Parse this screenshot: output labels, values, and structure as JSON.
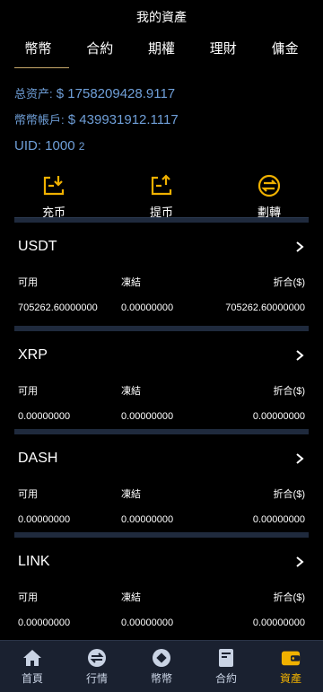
{
  "header": {
    "title": "我的資產"
  },
  "tabs": [
    {
      "label": "幣幣",
      "active": true
    },
    {
      "label": "合約"
    },
    {
      "label": "期權"
    },
    {
      "label": "理財"
    },
    {
      "label": "傭金"
    }
  ],
  "summary": {
    "total_label": "总资产:",
    "total_value": "$ 1758209428.9117",
    "coin_label": "幣幣帳戶:",
    "coin_value": "$ 439931912.1117",
    "uid_label": "UID:",
    "uid_value": "1000",
    "uid_suffix": "2"
  },
  "actions": [
    {
      "label": "充币",
      "icon": "deposit-icon"
    },
    {
      "label": "提币",
      "icon": "withdraw-icon"
    },
    {
      "label": "劃轉",
      "icon": "transfer-icon"
    }
  ],
  "columns": {
    "available": "可用",
    "frozen": "凍結",
    "converted": "折合($)"
  },
  "assets": [
    {
      "name": "USDT",
      "available": "705262.60000000",
      "frozen": "0.00000000",
      "converted": "705262.60000000"
    },
    {
      "name": "XRP",
      "available": "0.00000000",
      "frozen": "0.00000000",
      "converted": "0.00000000"
    },
    {
      "name": "DASH",
      "available": "0.00000000",
      "frozen": "0.00000000",
      "converted": "0.00000000"
    },
    {
      "name": "LINK",
      "available": "0.00000000",
      "frozen": "0.00000000",
      "converted": "0.00000000"
    }
  ],
  "nav": [
    {
      "label": "首頁",
      "icon": "home-icon"
    },
    {
      "label": "行情",
      "icon": "market-icon"
    },
    {
      "label": "幣幣",
      "icon": "coin-icon"
    },
    {
      "label": "合約",
      "icon": "contract-icon"
    },
    {
      "label": "資產",
      "icon": "wallet-icon",
      "active": true
    }
  ],
  "colors": {
    "accent": "#f0b100",
    "info": "#6f9fd8",
    "divider": "#1f2a3d",
    "nav_bg": "#1a2130"
  }
}
